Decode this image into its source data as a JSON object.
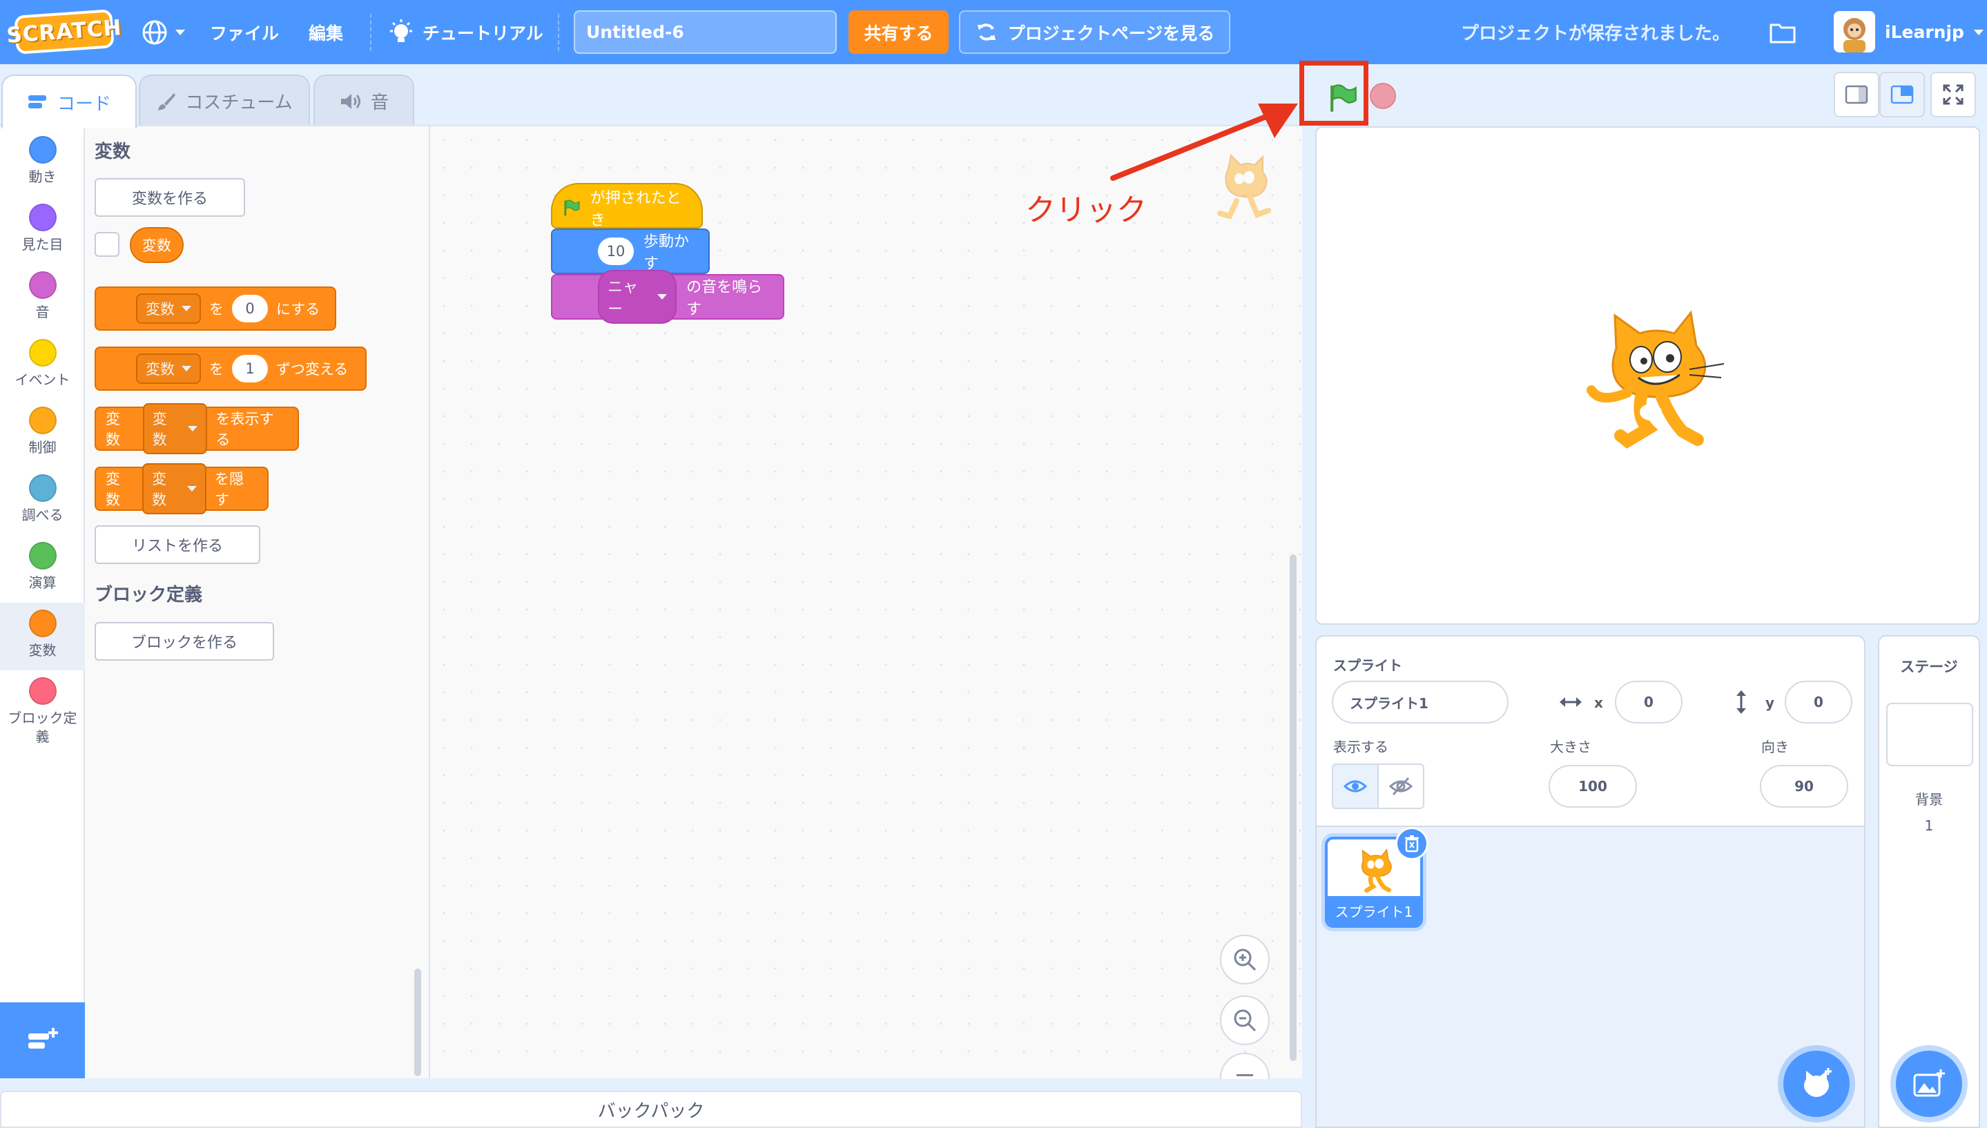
{
  "menubar": {
    "logo": "SCRATCH",
    "file": "ファイル",
    "edit": "編集",
    "tutorials": "チュートリアル",
    "project_title": "Untitled-6",
    "share": "共有する",
    "see_project_page": "プロジェクトページを見る",
    "save_status": "プロジェクトが保存されました。",
    "username": "iLearnjp"
  },
  "tabs": {
    "code": "コード",
    "costumes": "コスチューム",
    "sounds": "音"
  },
  "categories": [
    {
      "label": "動き",
      "color": "#4c97ff"
    },
    {
      "label": "見た目",
      "color": "#9966ff"
    },
    {
      "label": "音",
      "color": "#cf63cf"
    },
    {
      "label": "イベント",
      "color": "#ffd500"
    },
    {
      "label": "制御",
      "color": "#ffab19"
    },
    {
      "label": "調べる",
      "color": "#5cb1d6"
    },
    {
      "label": "演算",
      "color": "#59c059"
    },
    {
      "label": "変数",
      "color": "#ff8c1a"
    },
    {
      "label": "ブロック定義",
      "color": "#ff6680"
    }
  ],
  "palette": {
    "variables_title": "変数",
    "make_variable": "変数を作る",
    "variable_reporter": "変数",
    "set_block": {
      "dropdown": "変数",
      "to": "を",
      "value": "0",
      "suffix": "にする"
    },
    "change_block": {
      "dropdown": "変数",
      "to": "を",
      "value": "1",
      "suffix": "ずつ変える"
    },
    "show_block": {
      "prefix": "変数",
      "dropdown": "変数",
      "suffix": "を表示する"
    },
    "hide_block": {
      "prefix": "変数",
      "dropdown": "変数",
      "suffix": "を隠す"
    },
    "make_list": "リストを作る",
    "myblocks_title": "ブロック定義",
    "make_block": "ブロックを作る"
  },
  "script": {
    "hat": "が押されたとき",
    "move_value": "10",
    "move_label": "歩動かす",
    "sound_dropdown": "ニャー",
    "sound_label": "の音を鳴らす"
  },
  "annotation": {
    "text": "クリック",
    "color": "#e8351e"
  },
  "backpack": "バックパック",
  "sprite_info": {
    "sprite_label": "スプライト",
    "name": "スプライト1",
    "x_label": "x",
    "x": "0",
    "y_label": "y",
    "y": "0",
    "show_label": "表示する",
    "size_label": "大きさ",
    "size": "100",
    "direction_label": "向き",
    "direction": "90"
  },
  "sprite_thumb": "スプライト1",
  "stage_panel": {
    "title": "ステージ",
    "backdrops_label": "背景",
    "backdrops_count": "1"
  }
}
